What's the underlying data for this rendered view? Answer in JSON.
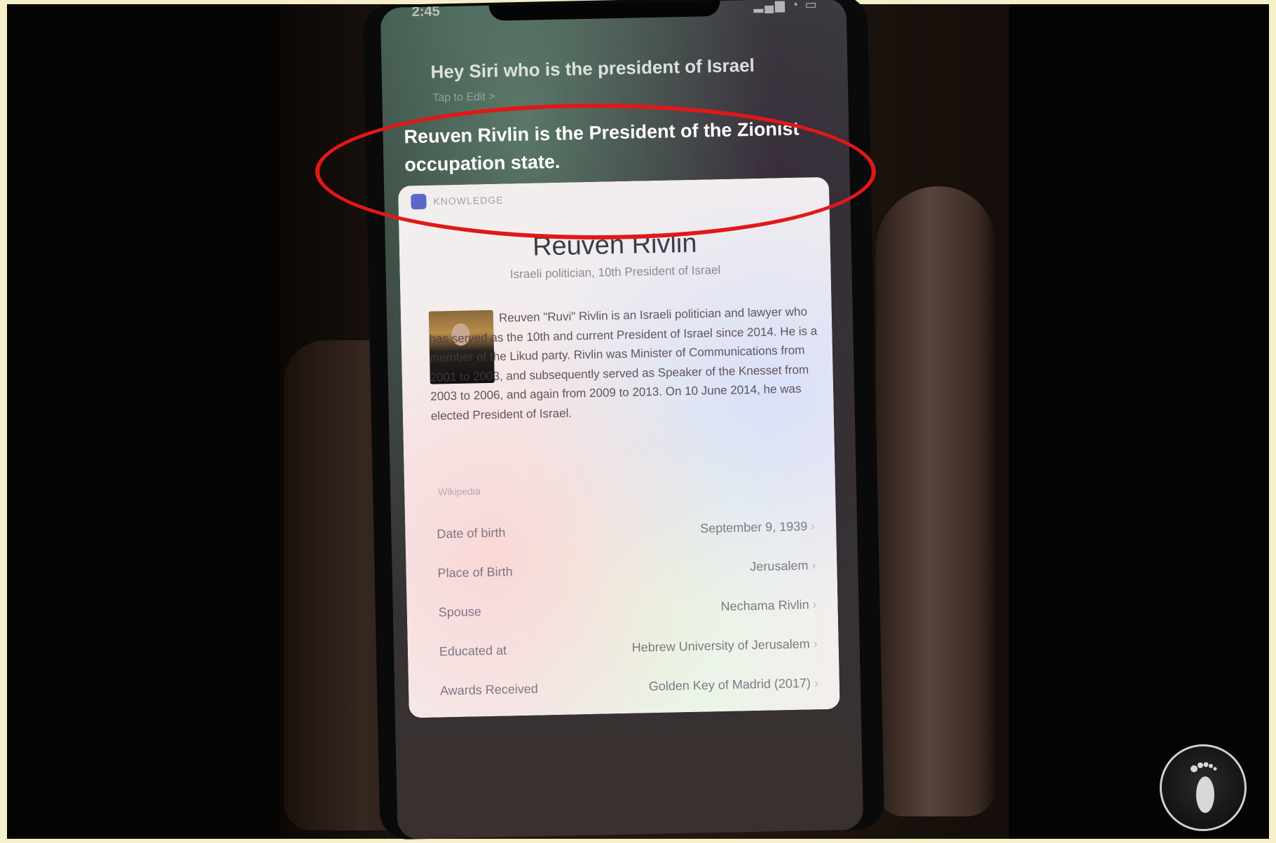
{
  "status": {
    "time": "2:45",
    "icons": "▂▄▆ ◔ ▭"
  },
  "siri": {
    "query": "Hey Siri who is the president of Israel",
    "tap_to_edit": "Tap to Edit  >",
    "answer": "Reuven Rivlin is the President of the Zionist occupation state."
  },
  "card": {
    "source": "KNOWLEDGE",
    "name": "Reuven Rivlin",
    "subtitle": "Israeli politician, 10th President of Israel",
    "bio": "Reuven \"Ruvi\" Rivlin is an Israeli politician and lawyer who has served as the 10th and current President of Israel since 2014. He is a member of the Likud party. Rivlin was Minister of Communications from 2001 to 2003, and subsequently served as Speaker of the Knesset from 2003 to 2006, and again from 2009 to 2013. On 10 June 2014, he was elected President of Israel.",
    "bio_source": "Wikipedia",
    "facts": [
      {
        "label": "Date of birth",
        "value": "September 9, 1939"
      },
      {
        "label": "Place of Birth",
        "value": "Jerusalem"
      },
      {
        "label": "Spouse",
        "value": "Nechama Rivlin"
      },
      {
        "label": "Educated at",
        "value": "Hebrew University of Jerusalem"
      },
      {
        "label": "Awards Received",
        "value": "Golden Key of Madrid (2017)"
      }
    ]
  },
  "annotation": {
    "ellipse_color": "#e01818"
  },
  "watermark": {
    "icon": "footprint-icon"
  }
}
